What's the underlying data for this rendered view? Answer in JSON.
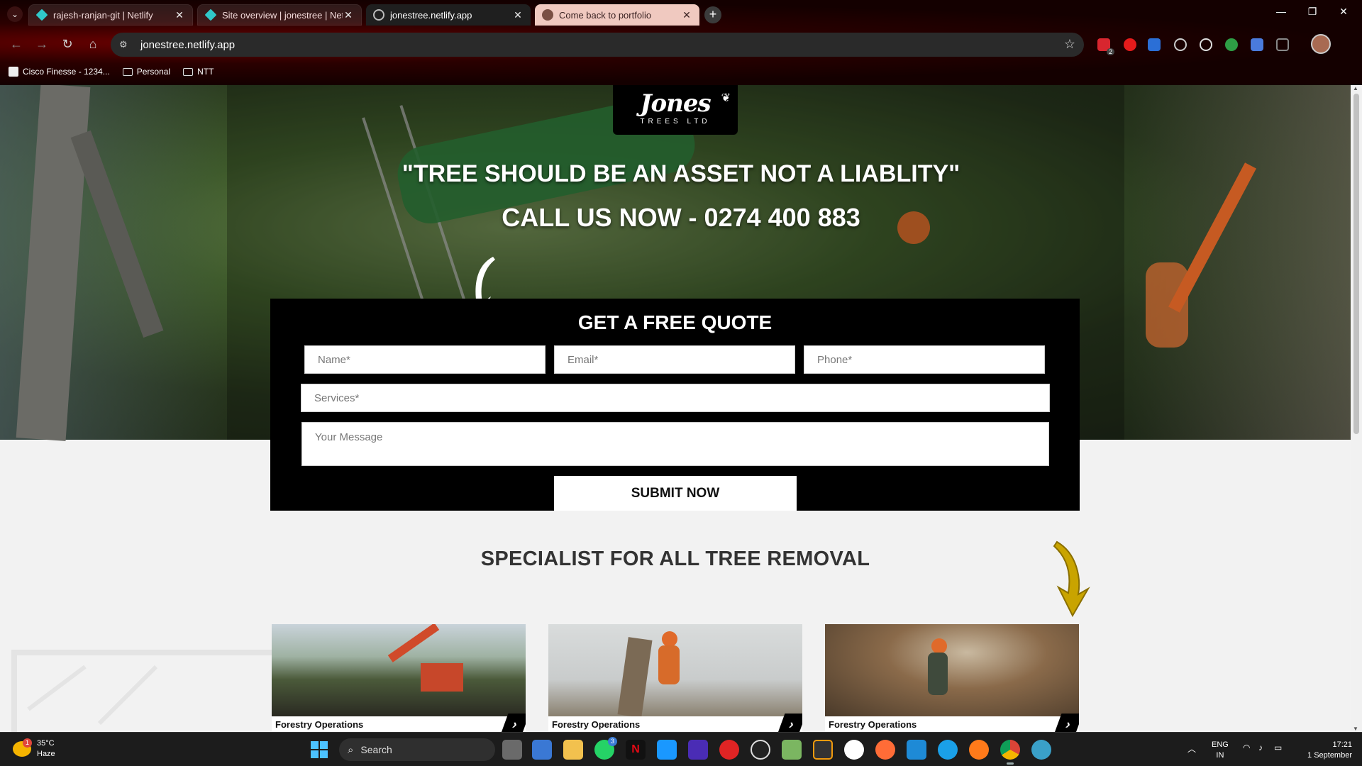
{
  "browser": {
    "tabs": [
      {
        "title": "rajesh-ranjan-git | Netlify",
        "icon": "netlify-icon",
        "state": "inactive"
      },
      {
        "title": "Site overview | jonestree | Netlify",
        "icon": "netlify-icon",
        "state": "inactive"
      },
      {
        "title": "jonestree.netlify.app",
        "icon": "globe-icon",
        "state": "active"
      },
      {
        "title": "Come back to portfolio",
        "icon": "person-icon",
        "state": "inactive"
      }
    ],
    "url": "jonestree.netlify.app",
    "bookmarks": [
      "Cisco Finesse - 1234...",
      "Personal",
      "NTT"
    ],
    "extension_badge": "2"
  },
  "page": {
    "logo": {
      "main": "Jones",
      "sub": "TREES LTD"
    },
    "tagline": "\"TREE SHOULD BE AN ASSET NOT A LIABLITY\"",
    "call_us": "CALL US NOW - 0274 400 883",
    "quote": {
      "title": "GET A FREE QUOTE",
      "name_placeholder": "Name*",
      "email_placeholder": "Email*",
      "phone_placeholder": "Phone*",
      "services_placeholder": "Services*",
      "message_placeholder": "Your Message",
      "submit_label": "SUBMIT NOW"
    },
    "specialist_heading": "SPECIALIST FOR ALL TREE REMOVAL",
    "cards": [
      {
        "label": "Forestry Operations"
      },
      {
        "label": "Forestry Operations"
      },
      {
        "label": "Forestry Operations"
      }
    ]
  },
  "taskbar": {
    "weather": {
      "temp": "35°C",
      "condition": "Haze",
      "badge": "1"
    },
    "search_label": "Search",
    "whatsapp_badge": "3",
    "lang_top": "ENG",
    "lang_bottom": "IN",
    "time": "17:21",
    "date": "1 September"
  },
  "colors": {
    "quote_bg": "#000000",
    "gold_arrow": "#c9a400",
    "chrome_theme": "#6b0000"
  }
}
